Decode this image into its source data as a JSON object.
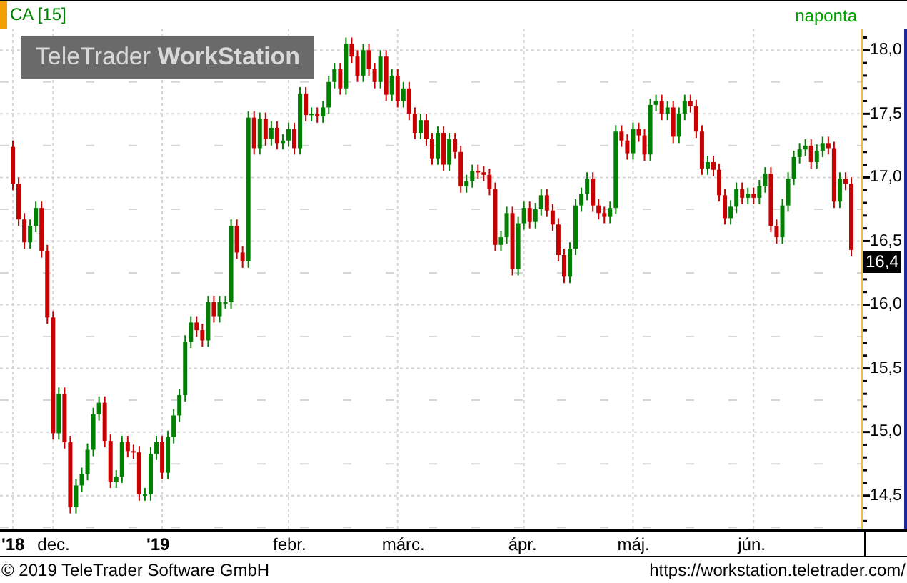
{
  "header": {
    "symbol": "CA [15]",
    "interval": "naponta"
  },
  "logo": "TeleTrader **WorkStation**",
  "chart": {
    "last_price_label": "16,4",
    "label_bold": [
      true,
      false,
      true,
      false,
      false,
      false,
      false,
      false
    ],
    "chart_data": {
      "type": "candlestick",
      "grid": true,
      "ylim": [
        14.24,
        18.17
      ],
      "yticks": [
        {
          "value": 14.5,
          "label": "14,5"
        },
        {
          "value": 15,
          "label": "15,0"
        },
        {
          "value": 15.5,
          "label": "15,5"
        },
        {
          "value": 16,
          "label": "16,0"
        },
        {
          "value": 16.5,
          "label": "16,5"
        },
        {
          "value": 17,
          "label": "17,0"
        },
        {
          "value": 17.5,
          "label": "17,5"
        },
        {
          "value": 18,
          "label": "18,0"
        }
      ],
      "categories": [
        "'18",
        null,
        null,
        null,
        null,
        null,
        null,
        "dec.",
        null,
        null,
        null,
        null,
        null,
        null,
        null,
        null,
        null,
        null,
        null,
        null,
        null,
        null,
        null,
        null,
        null,
        null,
        "'19",
        null,
        null,
        null,
        null,
        null,
        null,
        null,
        null,
        null,
        null,
        null,
        null,
        null,
        null,
        null,
        null,
        null,
        null,
        null,
        null,
        null,
        "febr.",
        null,
        null,
        null,
        null,
        null,
        null,
        null,
        null,
        null,
        null,
        null,
        null,
        null,
        null,
        null,
        null,
        null,
        null,
        "márc.",
        null,
        null,
        null,
        null,
        null,
        null,
        null,
        null,
        null,
        null,
        null,
        null,
        null,
        null,
        null,
        null,
        null,
        null,
        null,
        null,
        null,
        "ápr.",
        null,
        null,
        null,
        null,
        null,
        null,
        null,
        null,
        null,
        null,
        null,
        null,
        null,
        null,
        null,
        null,
        null,
        null,
        "máj.",
        null,
        null,
        null,
        null,
        null,
        null,
        null,
        null,
        null,
        null,
        null,
        null,
        null,
        null,
        null,
        null,
        null,
        null,
        null,
        null,
        "jún.",
        null,
        null,
        null,
        null,
        null,
        null,
        null,
        null,
        null,
        null,
        null,
        null,
        null,
        null,
        null,
        null,
        null
      ],
      "ohlc": [
        [
          17.24,
          17.29,
          16.9,
          16.95
        ],
        [
          16.95,
          17.0,
          16.62,
          16.67
        ],
        [
          16.67,
          16.72,
          16.44,
          16.49
        ],
        [
          16.49,
          16.67,
          16.44,
          16.62
        ],
        [
          16.62,
          16.81,
          16.57,
          16.76
        ],
        [
          16.76,
          16.81,
          16.37,
          16.42
        ],
        [
          16.42,
          16.47,
          15.85,
          15.9
        ],
        [
          15.9,
          15.95,
          14.94,
          14.99
        ],
        [
          14.99,
          15.35,
          14.94,
          15.3
        ],
        [
          15.3,
          15.35,
          14.87,
          14.92
        ],
        [
          14.92,
          14.97,
          14.36,
          14.41
        ],
        [
          14.41,
          14.63,
          14.36,
          14.58
        ],
        [
          14.58,
          14.72,
          14.53,
          14.67
        ],
        [
          14.67,
          14.91,
          14.62,
          14.86
        ],
        [
          14.86,
          15.19,
          14.81,
          15.14
        ],
        [
          15.14,
          15.28,
          15.09,
          15.23
        ],
        [
          15.23,
          15.28,
          14.88,
          14.93
        ],
        [
          14.93,
          14.98,
          14.56,
          14.61
        ],
        [
          14.61,
          14.7,
          14.56,
          14.65
        ],
        [
          14.65,
          14.97,
          14.6,
          14.92
        ],
        [
          14.92,
          14.97,
          14.8,
          14.85
        ],
        [
          14.85,
          14.9,
          14.79,
          14.84
        ],
        [
          14.84,
          14.89,
          14.46,
          14.51
        ],
        [
          14.51,
          14.56,
          14.46,
          14.51
        ],
        [
          14.51,
          14.88,
          14.46,
          14.83
        ],
        [
          14.83,
          14.97,
          14.78,
          14.92
        ],
        [
          14.92,
          14.97,
          14.63,
          14.68
        ],
        [
          14.68,
          15.01,
          14.63,
          14.96
        ],
        [
          14.96,
          15.18,
          14.91,
          15.13
        ],
        [
          15.13,
          15.34,
          15.08,
          15.29
        ],
        [
          15.29,
          15.76,
          15.24,
          15.71
        ],
        [
          15.71,
          15.91,
          15.66,
          15.86
        ],
        [
          15.86,
          15.91,
          15.75,
          15.8
        ],
        [
          15.8,
          15.85,
          15.67,
          15.72
        ],
        [
          15.72,
          16.07,
          15.67,
          16.02
        ],
        [
          16.02,
          16.07,
          15.86,
          15.91
        ],
        [
          15.91,
          16.07,
          15.86,
          16.02
        ],
        [
          16.02,
          16.07,
          15.97,
          16.02
        ],
        [
          16.02,
          16.67,
          15.97,
          16.62
        ],
        [
          16.62,
          16.67,
          16.36,
          16.41
        ],
        [
          16.41,
          16.46,
          16.29,
          16.34
        ],
        [
          16.34,
          17.52,
          16.29,
          17.47
        ],
        [
          17.47,
          17.52,
          17.18,
          17.23
        ],
        [
          17.23,
          17.51,
          17.18,
          17.46
        ],
        [
          17.46,
          17.51,
          17.25,
          17.3
        ],
        [
          17.3,
          17.44,
          17.25,
          17.39
        ],
        [
          17.39,
          17.44,
          17.22,
          17.27
        ],
        [
          17.27,
          17.34,
          17.22,
          17.29
        ],
        [
          17.29,
          17.43,
          17.24,
          17.38
        ],
        [
          17.38,
          17.43,
          17.18,
          17.23
        ],
        [
          17.23,
          17.71,
          17.18,
          17.66
        ],
        [
          17.66,
          17.71,
          17.44,
          17.49
        ],
        [
          17.49,
          17.55,
          17.44,
          17.5
        ],
        [
          17.5,
          17.55,
          17.43,
          17.48
        ],
        [
          17.48,
          17.6,
          17.43,
          17.55
        ],
        [
          17.55,
          17.8,
          17.5,
          17.75
        ],
        [
          17.75,
          17.9,
          17.7,
          17.85
        ],
        [
          17.85,
          17.9,
          17.65,
          17.7
        ],
        [
          17.7,
          18.1,
          17.65,
          18.05
        ],
        [
          18.05,
          18.1,
          17.9,
          17.95
        ],
        [
          17.95,
          18.0,
          17.75,
          17.8
        ],
        [
          17.8,
          18.05,
          17.75,
          18.0
        ],
        [
          18.0,
          18.05,
          17.8,
          17.85
        ],
        [
          17.85,
          17.9,
          17.7,
          17.75
        ],
        [
          17.75,
          18.0,
          17.7,
          17.95
        ],
        [
          17.95,
          18.0,
          17.6,
          17.65
        ],
        [
          17.65,
          17.85,
          17.6,
          17.8
        ],
        [
          17.8,
          17.85,
          17.55,
          17.6
        ],
        [
          17.6,
          17.75,
          17.55,
          17.7
        ],
        [
          17.7,
          17.75,
          17.45,
          17.5
        ],
        [
          17.5,
          17.55,
          17.3,
          17.35
        ],
        [
          17.35,
          17.5,
          17.3,
          17.45
        ],
        [
          17.45,
          17.5,
          17.25,
          17.3
        ],
        [
          17.3,
          17.35,
          17.1,
          17.15
        ],
        [
          17.15,
          17.4,
          17.1,
          17.35
        ],
        [
          17.35,
          17.4,
          17.05,
          17.1
        ],
        [
          17.1,
          17.35,
          17.05,
          17.3
        ],
        [
          17.3,
          17.35,
          17.15,
          17.2
        ],
        [
          17.2,
          17.25,
          16.88,
          16.93
        ],
        [
          16.93,
          17.02,
          16.88,
          16.97
        ],
        [
          16.97,
          17.1,
          16.92,
          17.05
        ],
        [
          17.05,
          17.1,
          16.99,
          17.04
        ],
        [
          17.04,
          17.09,
          16.97,
          17.02
        ],
        [
          17.02,
          17.07,
          16.86,
          16.91
        ],
        [
          16.91,
          16.96,
          16.42,
          16.47
        ],
        [
          16.47,
          16.58,
          16.42,
          16.53
        ],
        [
          16.53,
          16.77,
          16.48,
          16.72
        ],
        [
          16.72,
          16.77,
          16.23,
          16.28
        ],
        [
          16.28,
          16.69,
          16.23,
          16.64
        ],
        [
          16.64,
          16.81,
          16.59,
          16.76
        ],
        [
          16.76,
          16.81,
          16.6,
          16.65
        ],
        [
          16.65,
          16.8,
          16.6,
          16.75
        ],
        [
          16.75,
          16.91,
          16.7,
          16.86
        ],
        [
          16.86,
          16.91,
          16.69,
          16.74
        ],
        [
          16.74,
          16.79,
          16.58,
          16.63
        ],
        [
          16.63,
          16.68,
          16.34,
          16.39
        ],
        [
          16.39,
          16.44,
          16.17,
          16.22
        ],
        [
          16.22,
          16.49,
          16.17,
          16.44
        ],
        [
          16.44,
          16.83,
          16.39,
          16.78
        ],
        [
          16.78,
          16.92,
          16.73,
          16.87
        ],
        [
          16.87,
          17.04,
          16.82,
          16.99
        ],
        [
          16.99,
          17.04,
          16.73,
          16.78
        ],
        [
          16.78,
          16.83,
          16.67,
          16.72
        ],
        [
          16.72,
          16.77,
          16.64,
          16.69
        ],
        [
          16.69,
          16.81,
          16.64,
          16.76
        ],
        [
          16.76,
          17.41,
          16.71,
          17.36
        ],
        [
          17.36,
          17.41,
          17.24,
          17.29
        ],
        [
          17.29,
          17.34,
          17.14,
          17.19
        ],
        [
          17.19,
          17.43,
          17.14,
          17.38
        ],
        [
          17.38,
          17.43,
          17.28,
          17.33
        ],
        [
          17.33,
          17.38,
          17.13,
          17.18
        ],
        [
          17.18,
          17.62,
          17.13,
          17.57
        ],
        [
          17.57,
          17.65,
          17.52,
          17.6
        ],
        [
          17.6,
          17.65,
          17.45,
          17.5
        ],
        [
          17.5,
          17.6,
          17.45,
          17.55
        ],
        [
          17.55,
          17.6,
          17.27,
          17.32
        ],
        [
          17.32,
          17.55,
          17.27,
          17.5
        ],
        [
          17.5,
          17.65,
          17.45,
          17.6
        ],
        [
          17.6,
          17.65,
          17.51,
          17.56
        ],
        [
          17.56,
          17.61,
          17.31,
          17.36
        ],
        [
          17.36,
          17.41,
          17.02,
          17.07
        ],
        [
          17.07,
          17.17,
          17.02,
          17.12
        ],
        [
          17.12,
          17.17,
          17.01,
          17.06
        ],
        [
          17.06,
          17.11,
          16.81,
          16.86
        ],
        [
          16.86,
          16.91,
          16.63,
          16.68
        ],
        [
          16.68,
          16.82,
          16.63,
          16.77
        ],
        [
          16.77,
          16.96,
          16.72,
          16.91
        ],
        [
          16.91,
          16.96,
          16.79,
          16.84
        ],
        [
          16.84,
          16.92,
          16.79,
          16.87
        ],
        [
          16.87,
          16.92,
          16.79,
          16.84
        ],
        [
          16.84,
          16.98,
          16.79,
          16.93
        ],
        [
          16.93,
          17.08,
          16.88,
          17.03
        ],
        [
          17.03,
          17.08,
          16.57,
          16.62
        ],
        [
          16.62,
          16.67,
          16.48,
          16.53
        ],
        [
          16.53,
          16.83,
          16.48,
          16.78
        ],
        [
          16.78,
          17.04,
          16.73,
          16.99
        ],
        [
          16.99,
          17.21,
          16.94,
          17.16
        ],
        [
          17.16,
          17.27,
          17.11,
          17.22
        ],
        [
          17.22,
          17.3,
          17.17,
          17.25
        ],
        [
          17.25,
          17.3,
          17.07,
          17.12
        ],
        [
          17.12,
          17.26,
          17.07,
          17.21
        ],
        [
          17.21,
          17.32,
          17.16,
          17.27
        ],
        [
          17.27,
          17.32,
          17.18,
          17.23
        ],
        [
          17.23,
          17.28,
          16.76,
          16.81
        ],
        [
          16.81,
          17.04,
          16.76,
          16.99
        ],
        [
          16.99,
          17.04,
          16.9,
          16.95
        ],
        [
          16.95,
          17.0,
          16.38,
          16.43
        ]
      ]
    }
  },
  "footer": {
    "copyright": "© 2019 TeleTrader Software GmbH",
    "url": "https://workstation.teletrader.com/"
  }
}
